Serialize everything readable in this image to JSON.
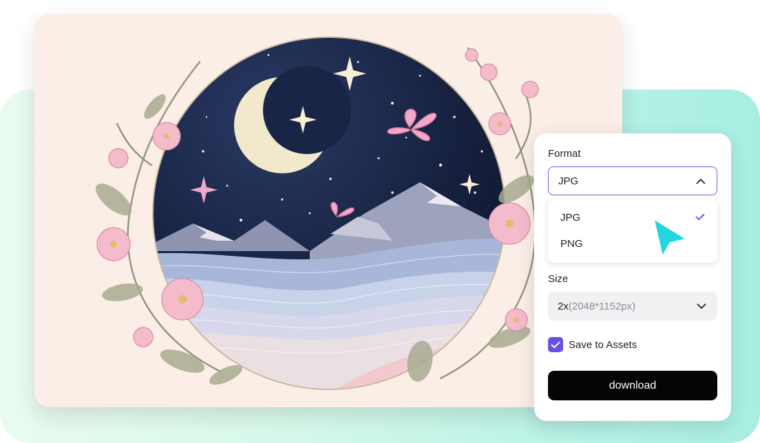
{
  "format": {
    "label": "Format",
    "selected": "JPG",
    "options": [
      {
        "label": "JPG",
        "checked": true
      },
      {
        "label": "PNG",
        "checked": false
      }
    ]
  },
  "size": {
    "label": "Size",
    "scale": "2x",
    "dimensions": "(2048*1152px)"
  },
  "save_to_assets": {
    "label": "Save to Assets",
    "checked": true
  },
  "download": {
    "label": "download"
  },
  "colors": {
    "accent": "#6a4fe6",
    "focus_border": "#6a5cf0",
    "cursor": "#22d6e0",
    "button": "#050505",
    "night_sky": "#14213f"
  },
  "icons": {
    "cursor": "pointer-cursor-icon",
    "chevron_up": "chevron-up-icon",
    "chevron_down": "chevron-down-icon",
    "check": "check-icon"
  }
}
